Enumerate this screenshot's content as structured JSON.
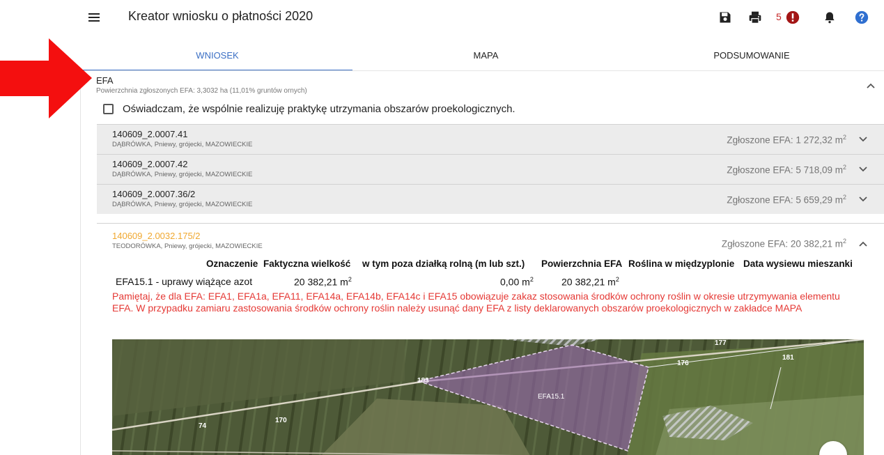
{
  "header": {
    "title": "Kreator wniosku o płatności 2020",
    "error_count": "5",
    "icons": [
      "menu-icon",
      "save-icon",
      "print-icon",
      "error-icon",
      "bell-icon",
      "help-icon"
    ]
  },
  "tabs": [
    {
      "label": "WNIOSEK",
      "active": true
    },
    {
      "label": "MAPA",
      "active": false
    },
    {
      "label": "PODSUMOWANIE",
      "active": false
    }
  ],
  "efa": {
    "title": "EFA",
    "subtitle": "Powierzchnia zgłoszonych EFA: 3,3032 ha (11,01% gruntów ornych)",
    "checkbox_label": "Oświadczam, że wspólnie realizuję praktykę utrzymania obszarów proekologicznych.",
    "checkbox_checked": false
  },
  "parcels": [
    {
      "id": "140609_2.0007.41",
      "location": "DĄBRÓWKA, Pniewy, grójecki, MAZOWIECKIE",
      "efa_label": "Zgłoszone EFA: 1 272,32 m",
      "unit_sup": "2"
    },
    {
      "id": "140609_2.0007.42",
      "location": "DĄBRÓWKA, Pniewy, grójecki, MAZOWIECKIE",
      "efa_label": "Zgłoszone EFA: 5 718,09 m",
      "unit_sup": "2"
    },
    {
      "id": "140609_2.0007.36/2",
      "location": "DĄBRÓWKA, Pniewy, grójecki, MAZOWIECKIE",
      "efa_label": "Zgłoszone EFA: 5 659,29 m",
      "unit_sup": "2"
    }
  ],
  "open_parcel": {
    "id": "140609_2.0032.175/2",
    "location": "TEODORÓWKA, Pniewy, grójecki, MAZOWIECKIE",
    "efa_label": "Zgłoszone EFA: 20 382,21 m",
    "unit_sup": "2",
    "columns": [
      "Oznaczenie",
      "Faktyczna wielkość",
      "w tym poza działką rolną (m lub szt.)",
      "Powierzchnia EFA",
      "Roślina w międzyplonie",
      "Data wysiewu mieszanki"
    ],
    "row": {
      "designation": "EFA15.1 - uprawy wiążące azot",
      "actual_size": "20 382,21 m",
      "outside": "0,00 m",
      "efa_area": "20 382,21 m",
      "sup": "2"
    },
    "warning": "Pamiętaj, że dla EFA: EFA1, EFA1a, EFA11, EFA14a, EFA14b, EFA14c i EFA15 obowiązuje zakaz stosowania środków ochrony roślin w okresie utrzymywania elementu EFA. W przypadku zamiaru zastosowania środków ochrony roślin należy usunąć dany EFA z listy deklarowanych obszarów proekologicznych w zakładce MAPA",
    "map": {
      "labels": [
        "177",
        "176",
        "181",
        "183",
        "EFA15.1",
        "74",
        "170"
      ],
      "efa_fill": "#9a6bb0"
    }
  },
  "colors": {
    "accent": "#3b6fc4",
    "warning": "#e53935",
    "selected_parcel": "#f0a830",
    "error": "#b71c1c"
  }
}
